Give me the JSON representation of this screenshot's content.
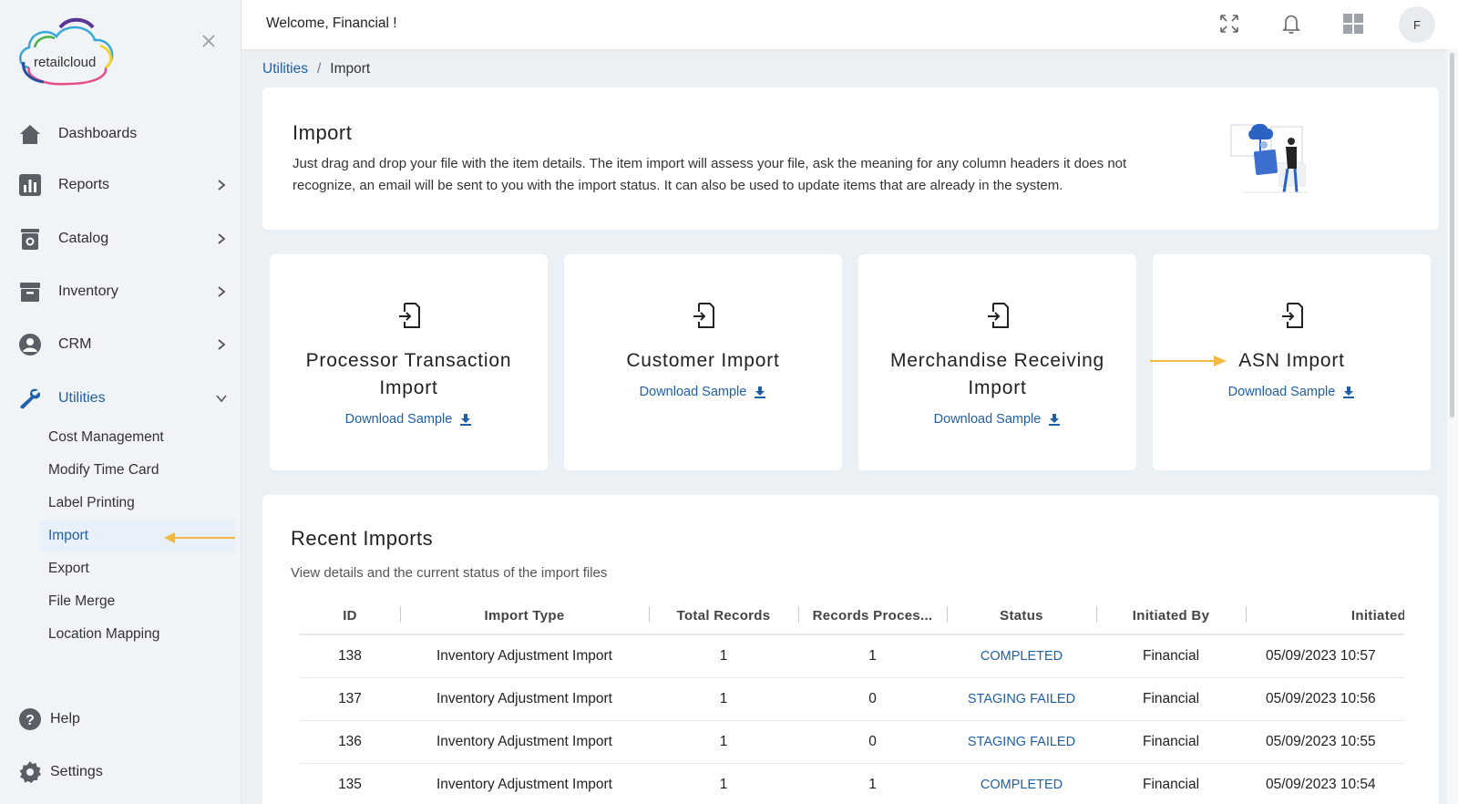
{
  "header": {
    "welcome": "Welcome, Financial !",
    "avatar_initial": "F"
  },
  "sidebar": {
    "logo_text": "retailcloud",
    "items": [
      {
        "label": "Dashboards",
        "icon": "home-icon"
      },
      {
        "label": "Reports",
        "icon": "bar-chart-icon"
      },
      {
        "label": "Catalog",
        "icon": "catalog-icon"
      },
      {
        "label": "Inventory",
        "icon": "archive-icon"
      },
      {
        "label": "CRM",
        "icon": "user-circle-icon"
      },
      {
        "label": "Utilities",
        "icon": "wrench-icon"
      }
    ],
    "utilities_sub": [
      "Cost Management",
      "Modify Time Card",
      "Label Printing",
      "Import",
      "Export",
      "File Merge",
      "Location Mapping"
    ],
    "help": "Help",
    "settings": "Settings"
  },
  "breadcrumb": {
    "parent": "Utilities",
    "separator": "/",
    "current": "Import"
  },
  "intro": {
    "title": "Import",
    "text": "Just drag and drop your file with the item details. The item import will assess your file, ask the meaning for any column headers it does not recognize, an email will be sent to you with the import status. It can also be used to update items that are already in the system."
  },
  "import_types": [
    {
      "name": "Processor Transaction Import",
      "download": "Download Sample"
    },
    {
      "name": "Customer Import",
      "download": "Download Sample"
    },
    {
      "name": "Merchandise Receiving Import",
      "download": "Download Sample"
    },
    {
      "name": "ASN Import",
      "download": "Download Sample"
    }
  ],
  "recent": {
    "title": "Recent Imports",
    "subtitle": "View details and the current status of the import files",
    "columns": [
      "ID",
      "Import Type",
      "Total Records",
      "Records Proces...",
      "Status",
      "Initiated By",
      "Initiated On"
    ],
    "rows": [
      {
        "id": "138",
        "type": "Inventory Adjustment Import",
        "total": "1",
        "processed": "1",
        "status": "COMPLETED",
        "by": "Financial",
        "on": "05/09/2023 10:57"
      },
      {
        "id": "137",
        "type": "Inventory Adjustment Import",
        "total": "1",
        "processed": "0",
        "status": "STAGING FAILED",
        "by": "Financial",
        "on": "05/09/2023 10:56"
      },
      {
        "id": "136",
        "type": "Inventory Adjustment Import",
        "total": "1",
        "processed": "0",
        "status": "STAGING FAILED",
        "by": "Financial",
        "on": "05/09/2023 10:55"
      },
      {
        "id": "135",
        "type": "Inventory Adjustment Import",
        "total": "1",
        "processed": "1",
        "status": "COMPLETED",
        "by": "Financial",
        "on": "05/09/2023 10:54"
      }
    ]
  },
  "colors": {
    "accent": "#1f5fa8",
    "annotation_arrow": "#f4b942",
    "background": "#ebf0f5"
  }
}
